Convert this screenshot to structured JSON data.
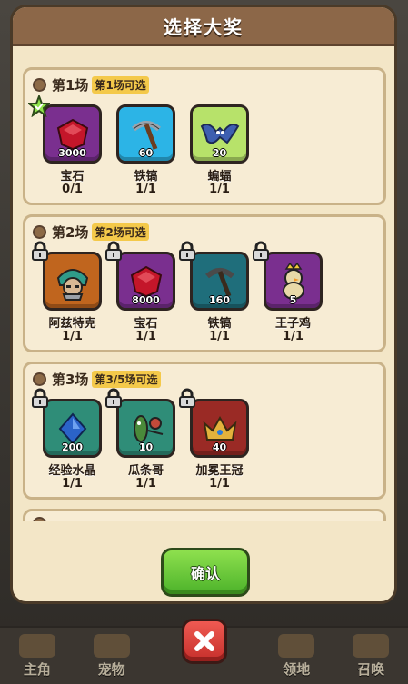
{
  "dialog": {
    "title": "选择大奖",
    "confirm_label": "确认"
  },
  "nav": {
    "items": [
      {
        "label": "主角"
      },
      {
        "label": "宠物"
      },
      {
        "label": "领地"
      },
      {
        "label": "召唤"
      }
    ]
  },
  "sections": [
    {
      "name": "第1场",
      "subtitle": "第1场可选",
      "items": [
        {
          "name": "宝石",
          "qty": "3000",
          "count": "0/1",
          "color": "#7a2f8f",
          "icon": "ruby-gem-icon",
          "selected": true
        },
        {
          "name": "铁镐",
          "qty": "60",
          "count": "1/1",
          "color": "#2cb4e6",
          "icon": "pickaxe-icon"
        },
        {
          "name": "蝙蝠",
          "qty": "20",
          "count": "1/1",
          "color": "#b7e26a",
          "icon": "bat-icon"
        }
      ]
    },
    {
      "name": "第2场",
      "subtitle": "第2场可选",
      "items": [
        {
          "name": "阿兹特克",
          "qty": "",
          "count": "1/1",
          "color": "#c0651e",
          "icon": "aztec-warrior-icon",
          "locked": true
        },
        {
          "name": "宝石",
          "qty": "8000",
          "count": "1/1",
          "color": "#7a2f8f",
          "icon": "ruby-gem-icon",
          "locked": true
        },
        {
          "name": "铁镐",
          "qty": "160",
          "count": "1/1",
          "color": "#1f6e7b",
          "icon": "pickaxe-icon",
          "locked": true
        },
        {
          "name": "王子鸡",
          "qty": "5",
          "count": "1/1",
          "color": "#7a2f8f",
          "icon": "prince-chicken-icon",
          "locked": true
        }
      ]
    },
    {
      "name": "第3场",
      "subtitle": "第3/5场可选",
      "items": [
        {
          "name": "经验水晶",
          "qty": "200",
          "count": "1/1",
          "color": "#2f8d78",
          "icon": "exp-crystal-icon",
          "locked": true
        },
        {
          "name": "瓜条哥",
          "qty": "10",
          "count": "1/1",
          "color": "#2f8d78",
          "icon": "cucumber-bro-icon",
          "locked": true
        },
        {
          "name": "加冕王冠",
          "qty": "40",
          "count": "1/1",
          "color": "#9a2a25",
          "icon": "crown-icon",
          "locked": true
        }
      ]
    }
  ]
}
